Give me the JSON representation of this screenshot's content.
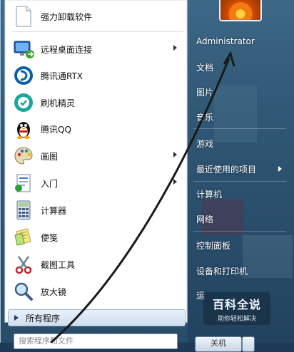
{
  "left_pane": {
    "programs": [
      {
        "label": "强力卸载软件",
        "icon": "document-icon",
        "has_submenu": false
      },
      {
        "label": "远程桌面连接",
        "icon": "remote-desktop-icon",
        "has_submenu": true
      },
      {
        "label": "腾讯通RTX",
        "icon": "rtx-icon",
        "has_submenu": false
      },
      {
        "label": "刷机精灵",
        "icon": "shuaji-icon",
        "has_submenu": false
      },
      {
        "label": "腾讯QQ",
        "icon": "qq-penguin-icon",
        "has_submenu": false
      },
      {
        "label": "画图",
        "icon": "paint-palette-icon",
        "has_submenu": true
      },
      {
        "label": "入门",
        "icon": "getting-started-icon",
        "has_submenu": true
      },
      {
        "label": "计算器",
        "icon": "calculator-icon",
        "has_submenu": false
      },
      {
        "label": "便笺",
        "icon": "sticky-notes-icon",
        "has_submenu": false
      },
      {
        "label": "截图工具",
        "icon": "snipping-tool-icon",
        "has_submenu": false
      },
      {
        "label": "放大镜",
        "icon": "magnifier-icon",
        "has_submenu": false
      }
    ],
    "all_programs_label": "所有程序",
    "search_placeholder": "搜索程序和文件"
  },
  "right_pane": {
    "items": [
      {
        "label": "Administrator",
        "has_submenu": false
      },
      {
        "label": "文档",
        "has_submenu": false
      },
      {
        "label": "图片",
        "has_submenu": false
      },
      {
        "label": "音乐",
        "has_submenu": false
      },
      {
        "label": "游戏",
        "has_submenu": false
      },
      {
        "label": "最近使用的项目",
        "has_submenu": true
      },
      {
        "label": "计算机",
        "has_submenu": false
      },
      {
        "label": "网络",
        "has_submenu": false
      },
      {
        "label": "控制面板",
        "has_submenu": false
      },
      {
        "label": "设备和打印机",
        "has_submenu": false
      },
      {
        "label": "运",
        "has_submenu": false
      }
    ],
    "shutdown_label": "关机"
  },
  "watermark": {
    "title": "百科全说",
    "subtitle": "助你轻松解决"
  },
  "colors": {
    "menu_accent": "#1f3e63",
    "right_pane_text": "#ffffff"
  }
}
